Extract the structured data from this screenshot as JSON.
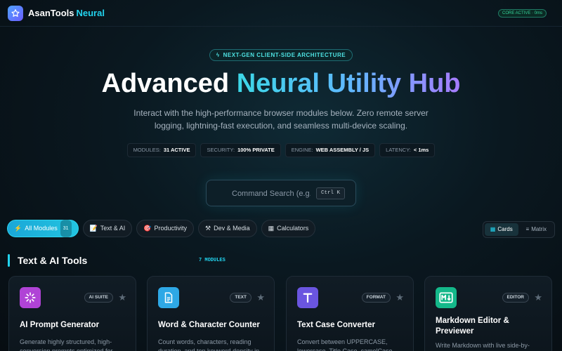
{
  "app": {
    "name": "AsanTools",
    "name_accent": "Neural",
    "status": "CORE ACTIVE · 0ms"
  },
  "hero": {
    "eyebrow": "NEXT-GEN CLIENT-SIDE ARCHITECTURE",
    "title_plain": "Advanced",
    "title_gradient": "Neural Utility Hub",
    "subtitle": "Interact with the high-performance browser modules below. Zero remote server logging, lightning-fast execution, and seamless multi-device scaling."
  },
  "stats": [
    {
      "label": "MODULES:",
      "value": "31 ACTIVE"
    },
    {
      "label": "SECURITY:",
      "value": "100% PRIVATE"
    },
    {
      "label": "ENGINE:",
      "value": "WEB ASSEMBLY / JS"
    },
    {
      "label": "LATENCY:",
      "value": "< 1ms"
    }
  ],
  "search": {
    "placeholder": "Command Search (e.g. AI)",
    "shortcut": "Ctrl K"
  },
  "tabs": [
    {
      "icon": "⚡",
      "label": "All Modules",
      "count": "31",
      "active": true
    },
    {
      "icon": "📝",
      "label": "Text & AI"
    },
    {
      "icon": "🎯",
      "label": "Productivity"
    },
    {
      "icon": "⚒",
      "label": "Dev & Media"
    },
    {
      "icon": "▦",
      "label": "Calculators"
    }
  ],
  "view": {
    "cards": "Cards",
    "matrix": "Matrix"
  },
  "section": {
    "title": "Text & AI Tools",
    "count": "7 MODULES"
  },
  "cards": [
    {
      "tag": "AI SUITE",
      "title": "AI Prompt Generator",
      "desc": "Generate highly structured, high-conversion prompts optimized for",
      "icon": "sparkle-icon",
      "color": "#b043d6"
    },
    {
      "tag": "TEXT",
      "title": "Word & Character Counter",
      "desc": "Count words, characters, reading duration, and top keyword density in",
      "icon": "document-icon",
      "color": "#2ea8e6"
    },
    {
      "tag": "FORMAT",
      "title": "Text Case Converter",
      "desc": "Convert between UPPERCASE, lowercase, Title Case, camelCase",
      "icon": "text-t-icon",
      "color": "#6a55e0"
    },
    {
      "tag": "EDITOR",
      "title": "Markdown Editor & Previewer",
      "desc": "Write Markdown with live side-by-",
      "icon": "markdown-icon",
      "color": "#14b88a"
    }
  ]
}
